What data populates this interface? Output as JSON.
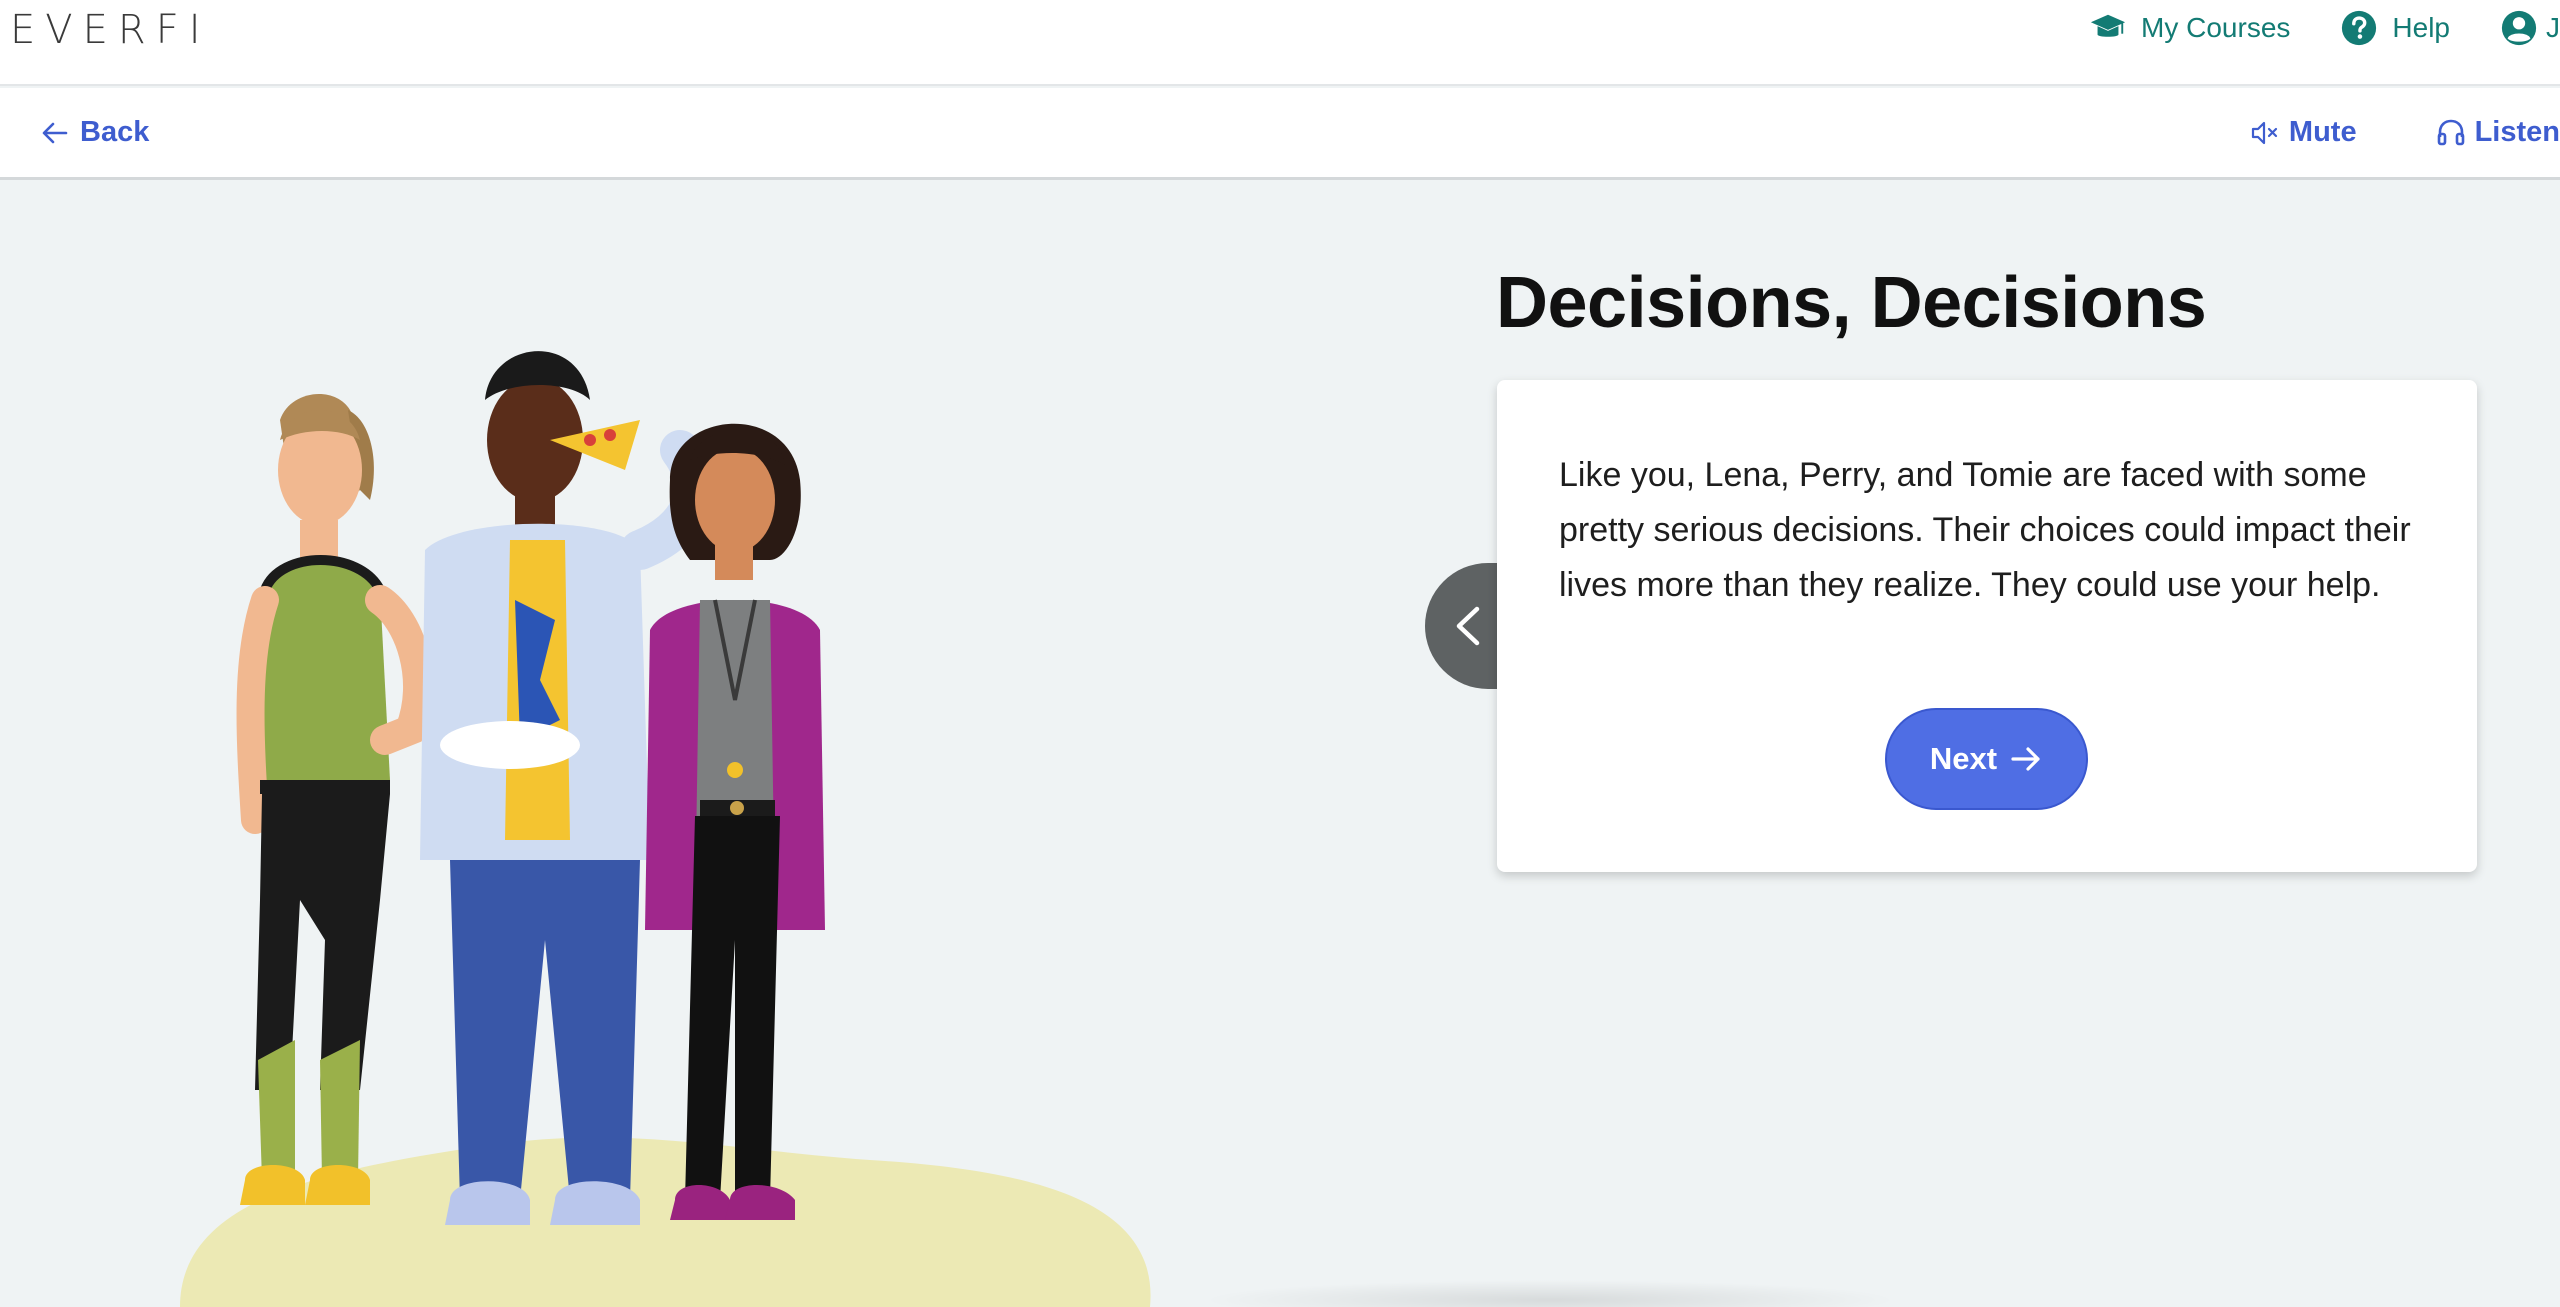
{
  "header": {
    "logo_text": "EVERFI",
    "nav": {
      "my_courses": "My Courses",
      "help": "Help",
      "account_initial": "J"
    }
  },
  "toolbar": {
    "back_label": "Back",
    "mute_label": "Mute",
    "listen_label": "Listen"
  },
  "slide": {
    "title": "Decisions, Decisions",
    "body": "Like you, Lena, Perry, and Tomie are faced with some pretty serious decisions. Their choices could impact their lives more than they realize. They could use your help.",
    "next_label": "Next"
  },
  "colors": {
    "brand_teal": "#137b74",
    "link_blue": "#3e5dcf",
    "primary_button": "#4f6ee4",
    "page_background": "#eff3f4",
    "logo_accent": "#d8403a"
  },
  "icons": {
    "my_courses": "graduation-cap-icon",
    "help": "question-circle-icon",
    "account": "user-circle-icon",
    "back": "arrow-left-icon",
    "mute": "speaker-muted-icon",
    "listen": "headphones-icon",
    "next": "arrow-right-icon",
    "previous": "chevron-left-icon"
  }
}
